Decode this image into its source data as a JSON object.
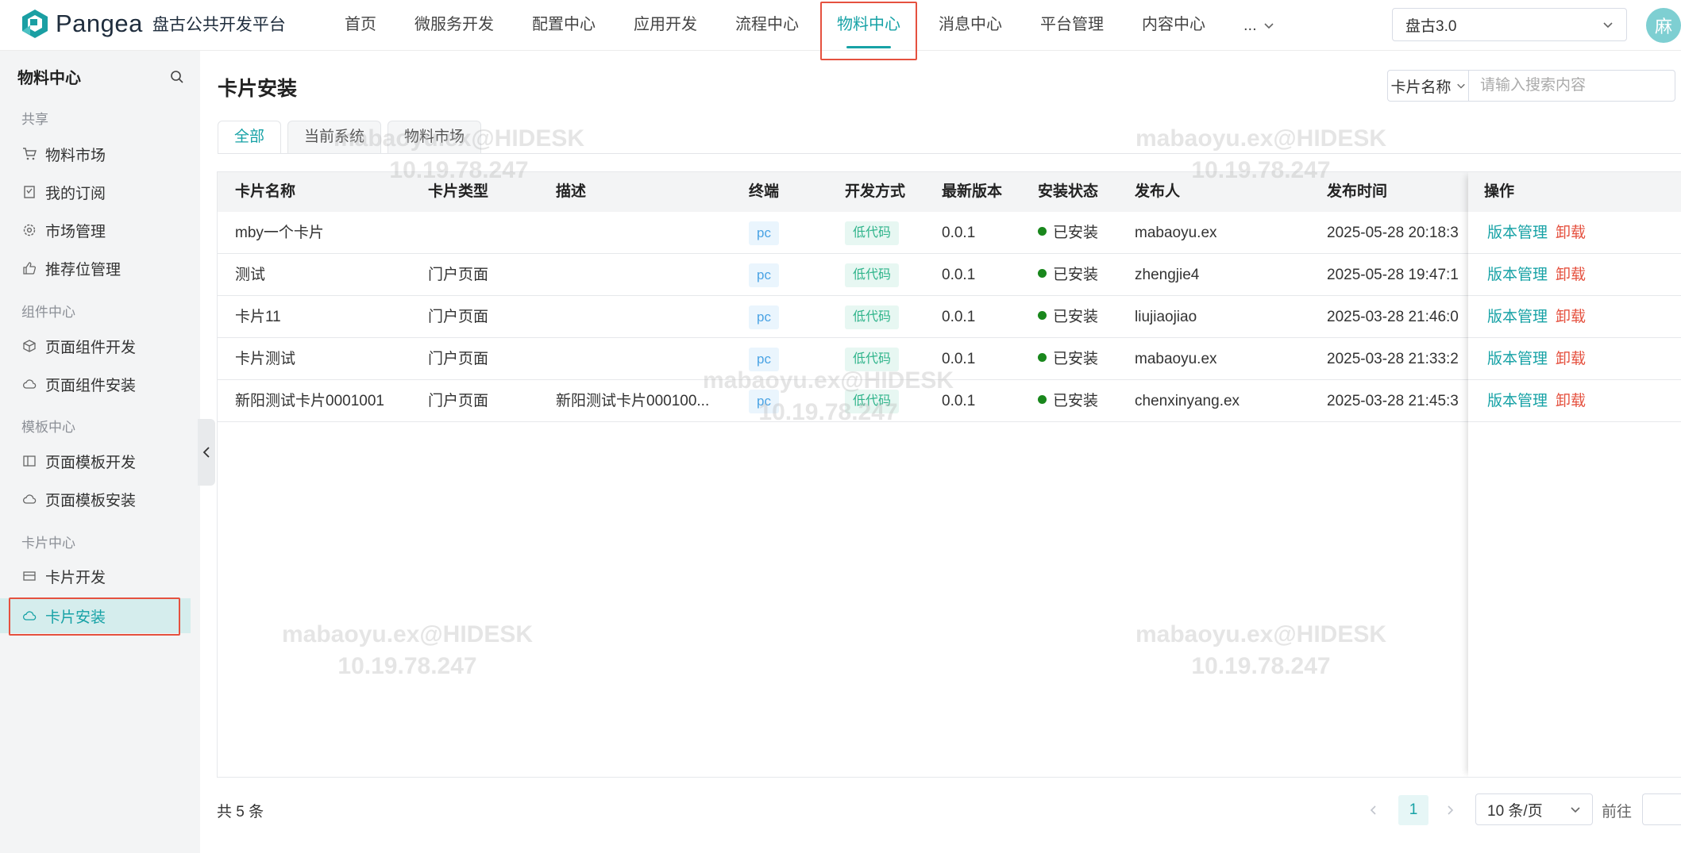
{
  "header": {
    "logo_text": "Pangea",
    "logo_subtitle": "盘古公共开发平台",
    "nav": [
      {
        "label": "首页"
      },
      {
        "label": "微服务开发"
      },
      {
        "label": "配置中心"
      },
      {
        "label": "应用开发"
      },
      {
        "label": "流程中心"
      },
      {
        "label": "物料中心",
        "active": true
      },
      {
        "label": "消息中心"
      },
      {
        "label": "平台管理"
      },
      {
        "label": "内容中心"
      }
    ],
    "nav_more_label": "...",
    "system_select": "盘古3.0",
    "avatar_text": "麻"
  },
  "sidebar": {
    "title": "物料中心",
    "groups": [
      {
        "label": "共享"
      },
      {
        "label": "组件中心"
      },
      {
        "label": "模板中心"
      },
      {
        "label": "卡片中心"
      }
    ],
    "items": [
      {
        "label": "物料市场",
        "icon": "cart-icon"
      },
      {
        "label": "我的订阅",
        "icon": "bookmark-icon"
      },
      {
        "label": "市场管理",
        "icon": "gear-icon"
      },
      {
        "label": "推荐位管理",
        "icon": "thumbs-up-icon"
      },
      {
        "label": "页面组件开发",
        "icon": "cube-icon"
      },
      {
        "label": "页面组件安装",
        "icon": "cloud-icon"
      },
      {
        "label": "页面模板开发",
        "icon": "layout-icon"
      },
      {
        "label": "页面模板安装",
        "icon": "cloud-icon"
      },
      {
        "label": "卡片开发",
        "icon": "card-icon"
      },
      {
        "label": "卡片安装",
        "icon": "cloud-icon",
        "active": true
      }
    ]
  },
  "main": {
    "title": "卡片安装",
    "search": {
      "type_label": "卡片名称",
      "placeholder": "请输入搜索内容"
    },
    "tabs": [
      {
        "label": "全部",
        "active": true
      },
      {
        "label": "当前系统"
      },
      {
        "label": "物料市场"
      }
    ],
    "table": {
      "columns": [
        "卡片名称",
        "卡片类型",
        "描述",
        "终端",
        "开发方式",
        "最新版本",
        "安装状态",
        "发布人",
        "发布时间",
        "操作"
      ],
      "rows": [
        {
          "name": "mby一个卡片",
          "type": "",
          "desc": "",
          "terminal": "pc",
          "dev": "低代码",
          "version": "0.0.1",
          "status": "已安装",
          "publisher": "mabaoyu.ex",
          "time": "2025-05-28 20:18:3"
        },
        {
          "name": "测试",
          "type": "门户页面",
          "desc": "",
          "terminal": "pc",
          "dev": "低代码",
          "version": "0.0.1",
          "status": "已安装",
          "publisher": "zhengjie4",
          "time": "2025-05-28 19:47:1"
        },
        {
          "name": "卡片11",
          "type": "门户页面",
          "desc": "",
          "terminal": "pc",
          "dev": "低代码",
          "version": "0.0.1",
          "status": "已安装",
          "publisher": "liujiaojiao",
          "time": "2025-03-28 21:46:0"
        },
        {
          "name": "卡片测试",
          "type": "门户页面",
          "desc": "",
          "terminal": "pc",
          "dev": "低代码",
          "version": "0.0.1",
          "status": "已安装",
          "publisher": "mabaoyu.ex",
          "time": "2025-03-28 21:33:2"
        },
        {
          "name": "新阳测试卡片0001001",
          "type": "门户页面",
          "desc": "新阳测试卡片000100...",
          "terminal": "pc",
          "dev": "低代码",
          "version": "0.0.1",
          "status": "已安装",
          "publisher": "chenxinyang.ex",
          "time": "2025-03-28 21:45:3"
        }
      ],
      "op_manage": "版本管理",
      "op_uninstall": "卸载"
    },
    "pagination": {
      "total": "共 5 条",
      "current_page": "1",
      "page_size": "10 条/页",
      "goto_label": "前往"
    }
  },
  "watermark": {
    "line1": "mabaoyu.ex@HIDESK",
    "line2": "10.19.78.247"
  },
  "colors": {
    "accent": "#17a2a6",
    "danger": "#e5513f",
    "status_ok": "#19871c"
  }
}
